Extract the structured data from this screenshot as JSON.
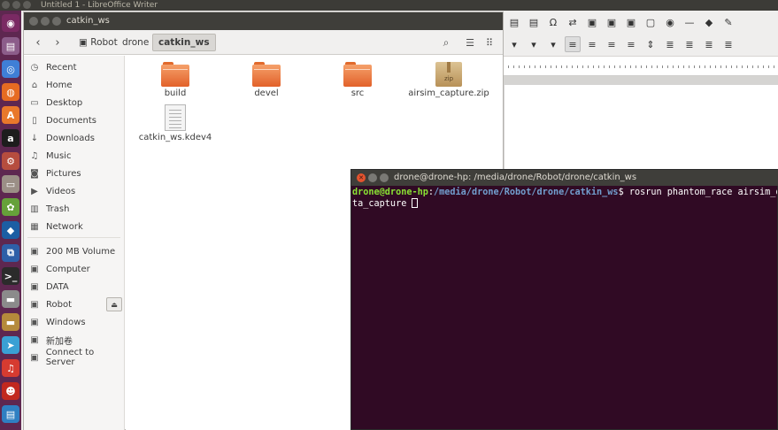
{
  "top_panel": {
    "title": "Untitled 1 - LibreOffice Writer"
  },
  "launcher": {
    "items": [
      {
        "icon": "dash-icon",
        "glyph": "◉",
        "color": "#7a2a63"
      },
      {
        "icon": "files-icon",
        "glyph": "▤",
        "color": "#8c5d8a"
      },
      {
        "icon": "chromium-icon",
        "glyph": "◎",
        "color": "#3f7fd6"
      },
      {
        "icon": "firefox-icon",
        "glyph": "◍",
        "color": "#e66b22"
      },
      {
        "icon": "software-center-icon",
        "glyph": "A",
        "color": "#e9782b"
      },
      {
        "icon": "amazon-icon",
        "glyph": "a",
        "color": "#1d1d1d"
      },
      {
        "icon": "settings-icon",
        "glyph": "⚙",
        "color": "#b64d3e"
      },
      {
        "icon": "disk-icon",
        "glyph": "▭",
        "color": "#9b8f86"
      },
      {
        "icon": "gimp-icon",
        "glyph": "✿",
        "color": "#66a13a"
      },
      {
        "icon": "qtcreator-icon",
        "glyph": "◆",
        "color": "#1c5ea3"
      },
      {
        "icon": "vscode-icon",
        "glyph": "⧉",
        "color": "#2e5fa8"
      },
      {
        "icon": "terminal-icon",
        "glyph": ">_",
        "color": "#2b2b2b"
      },
      {
        "icon": "drive-icon",
        "glyph": "▬",
        "color": "#8b8b8b"
      },
      {
        "icon": "drive-usb-icon",
        "glyph": "▬",
        "color": "#b58a3b"
      },
      {
        "icon": "telegram-icon",
        "glyph": "➤",
        "color": "#3aa0d4"
      },
      {
        "icon": "netease-music-icon",
        "glyph": "♫",
        "color": "#d63b30"
      },
      {
        "icon": "qq-icon",
        "glyph": "☻",
        "color": "#c2281f"
      },
      {
        "icon": "writer-icon",
        "glyph": "▤",
        "color": "#2f7fc2"
      }
    ]
  },
  "libreoffice": {
    "row1": [
      "▤",
      "▤",
      "Ω",
      "⇄",
      "▣",
      "▣",
      "▣",
      "▢",
      "◉",
      "—",
      "◆",
      "✎"
    ],
    "row2": [
      "▾",
      "▾",
      "▾",
      "≡",
      "≡",
      "≡",
      "≡",
      "⇕",
      "≣",
      "≣",
      "≣",
      "≣"
    ]
  },
  "nautilus": {
    "title": "catkin_ws",
    "breadcrumbs": {
      "root": "Robot",
      "middle": "drone",
      "current": "catkin_ws"
    },
    "sidebar": [
      {
        "label": "Recent",
        "icon": "clock-icon",
        "glyph": "◷"
      },
      {
        "label": "Home",
        "icon": "home-icon",
        "glyph": "⌂"
      },
      {
        "label": "Desktop",
        "icon": "desktop-icon",
        "glyph": "▭"
      },
      {
        "label": "Documents",
        "icon": "documents-icon",
        "glyph": "▯"
      },
      {
        "label": "Downloads",
        "icon": "downloads-icon",
        "glyph": "↓"
      },
      {
        "label": "Music",
        "icon": "music-icon",
        "glyph": "♫"
      },
      {
        "label": "Pictures",
        "icon": "pictures-icon",
        "glyph": "◙"
      },
      {
        "label": "Videos",
        "icon": "videos-icon",
        "glyph": "▶"
      },
      {
        "label": "Trash",
        "icon": "trash-icon",
        "glyph": "▥"
      },
      {
        "label": "Network",
        "icon": "network-icon",
        "glyph": "▦"
      },
      {
        "label": "200 MB Volume",
        "icon": "drive-icon",
        "glyph": "▣"
      },
      {
        "label": "Computer",
        "icon": "computer-icon",
        "glyph": "▣"
      },
      {
        "label": "DATA",
        "icon": "drive-icon",
        "glyph": "▣"
      },
      {
        "label": "Robot",
        "icon": "drive-icon",
        "glyph": "▣"
      },
      {
        "label": "Windows",
        "icon": "drive-icon",
        "glyph": "▣"
      },
      {
        "label": "新加卷",
        "icon": "drive-icon",
        "glyph": "▣"
      },
      {
        "label": "Connect to Server",
        "icon": "server-icon",
        "glyph": "▣"
      }
    ],
    "files": [
      {
        "name": "build",
        "type": "folder"
      },
      {
        "name": "devel",
        "type": "folder"
      },
      {
        "name": "src",
        "type": "folder"
      },
      {
        "name": "airsim_capture.zip",
        "type": "zip",
        "badge": "zip"
      },
      {
        "name": "catkin_ws.kdev4",
        "type": "document"
      }
    ]
  },
  "terminal": {
    "title": "drone@drone-hp: /media/drone/Robot/drone/catkin_ws",
    "user_host": "drone@drone-hp",
    "sep": ":",
    "path": "/media/drone/Robot/drone/catkin_ws",
    "prompt_char": "$",
    "command_line1": " rosrun phantom_race airsim_da",
    "command_line2": "ta_capture "
  }
}
